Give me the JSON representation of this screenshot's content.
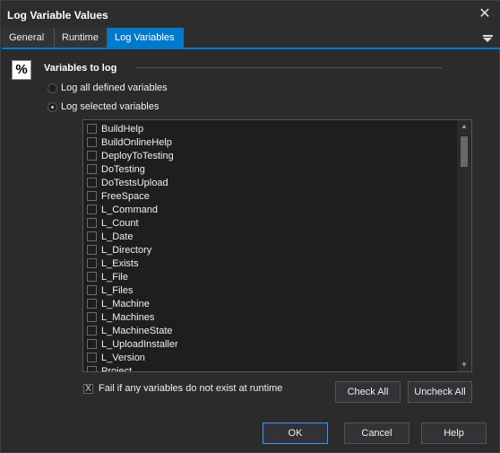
{
  "window": {
    "title": "Log Variable Values"
  },
  "tabs": [
    {
      "label": "General",
      "active": false
    },
    {
      "label": "Runtime",
      "active": false
    },
    {
      "label": "Log Variables",
      "active": true
    }
  ],
  "group": {
    "icon_glyph": "%",
    "title": "Variables to log"
  },
  "radios": [
    {
      "label": "Log all defined variables",
      "checked": false
    },
    {
      "label": "Log selected variables",
      "checked": true
    }
  ],
  "variables": [
    "BuildHelp",
    "BuildOnlineHelp",
    "DeployToTesting",
    "DoTesting",
    "DoTestsUpload",
    "FreeSpace",
    "L_Command",
    "L_Count",
    "L_Date",
    "L_Directory",
    "L_Exists",
    "L_File",
    "L_Files",
    "L_Machine",
    "L_Machines",
    "L_MachineState",
    "L_UploadInstaller",
    "L_Version",
    "Project"
  ],
  "fail_option": {
    "label": "Fail if any variables do not exist at runtime",
    "checked": true,
    "glyph": "X"
  },
  "buttons": {
    "check_all": "Check All",
    "uncheck_all": "Uncheck All",
    "ok": "OK",
    "cancel": "Cancel",
    "help": "Help"
  },
  "icons": {
    "close": "close-icon",
    "tab_menu": "menu-icon",
    "scroll_up": "▲",
    "scroll_down": "▼",
    "close_glyph": "✕"
  },
  "colors": {
    "accent": "#007acc",
    "background": "#2b2b2b",
    "text": "#f0f0f0"
  }
}
